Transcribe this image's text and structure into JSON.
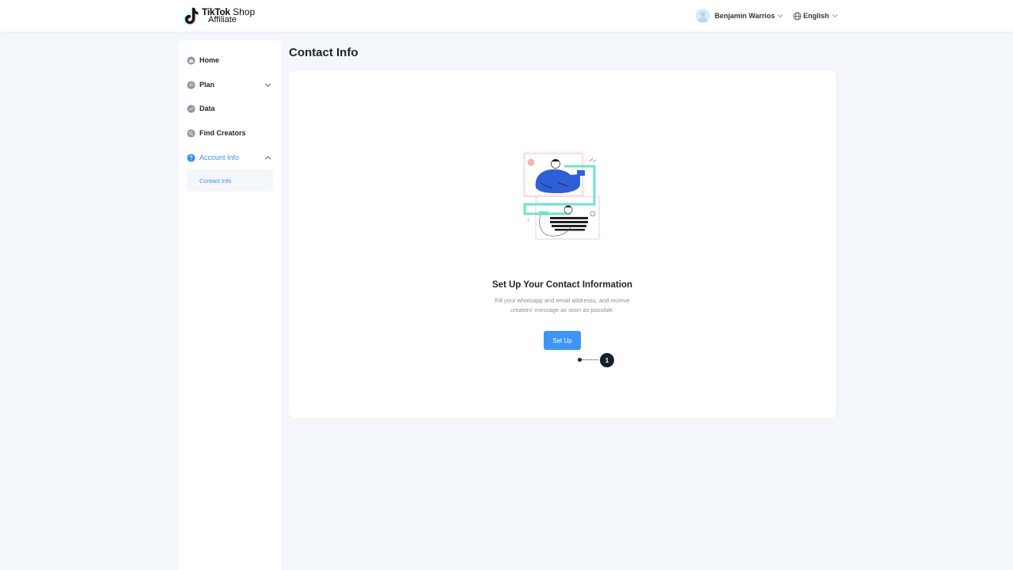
{
  "header": {
    "logo_brand": "TikTok",
    "logo_shop": "Shop",
    "logo_sub": "Affiliate",
    "user_name": "Benjamin Warrios",
    "language": "English"
  },
  "sidebar": {
    "items": [
      {
        "label": "Home",
        "icon": "home-icon"
      },
      {
        "label": "Plan",
        "icon": "plan-icon",
        "caret": "down"
      },
      {
        "label": "Data",
        "icon": "data-icon"
      },
      {
        "label": "Find Creators",
        "icon": "search-creators-icon"
      },
      {
        "label": "Account Info",
        "icon": "help-icon",
        "caret": "up",
        "active": true
      }
    ],
    "sub_items": [
      {
        "label": "Contact Info",
        "selected": true
      }
    ]
  },
  "main": {
    "page_title": "Contact Info",
    "heading": "Set Up Your Contact Information",
    "description": "Fill your whatsapp and email addresss, and receive creators' message as soon as possible.",
    "setup_button": "Set Up",
    "step_badge": "1"
  },
  "colors": {
    "accent": "#3d95f5",
    "active_text": "#3b8ff0",
    "background": "#f3f6fa",
    "badge": "#1a1f2e"
  }
}
